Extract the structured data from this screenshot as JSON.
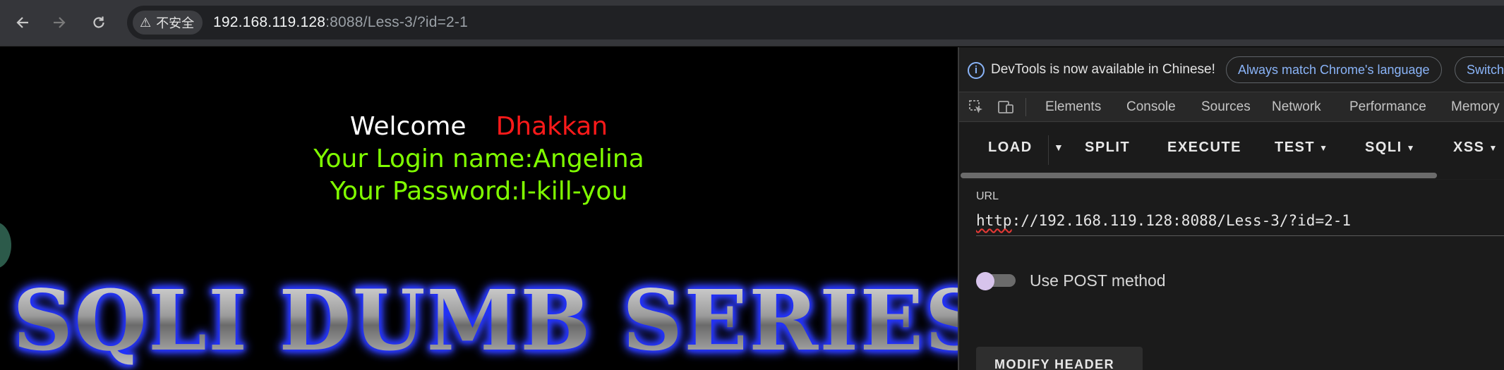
{
  "browser": {
    "security_label": "不安全",
    "url_host": "192.168.119.128",
    "url_rest": ":8088/Less-3/?id=2-1"
  },
  "page": {
    "welcome_word": "Welcome",
    "welcome_name": "Dhakkan",
    "login_line": "Your Login name:Angelina",
    "password_line": "Your Password:I-kill-you",
    "banner": "SQLI DUMB SERIES"
  },
  "devtools": {
    "info_text": "DevTools is now available in Chinese!",
    "match_language_button": "Always match Chrome's language",
    "switch_button": "Switch",
    "tabs": [
      "Elements",
      "Console",
      "Sources",
      "Network",
      "Performance",
      "Memory"
    ]
  },
  "hackbar": {
    "buttons": {
      "load": "LOAD",
      "split": "SPLIT",
      "execute": "EXECUTE",
      "test": "TEST",
      "sqli": "SQLI",
      "xss": "XSS"
    },
    "url_label": "URL",
    "url_scheme": "http",
    "url_rest": "://192.168.119.128:8088/Less-3/?id=2-1",
    "post_toggle_label": "Use POST method",
    "post_enabled": false,
    "modify_header_button": "MODIFY HEADER"
  },
  "colors": {
    "welcome_name": "#ff1a1a",
    "login_text": "#80ff00",
    "banner_glow": "#1a2bff",
    "devtools_accent": "#8ab4f8"
  }
}
